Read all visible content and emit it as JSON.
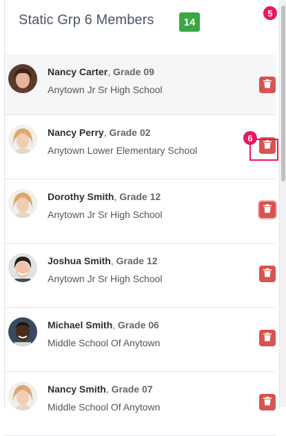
{
  "header": {
    "title": "Static Grp 6 Members",
    "member_count": "14"
  },
  "markers": {
    "m5": "5",
    "m6": "6"
  },
  "members": [
    {
      "name": "Nancy Carter",
      "sep": ", ",
      "grade": "Grade 09",
      "school": "Anytown Jr Sr High School"
    },
    {
      "name": "Nancy Perry",
      "sep": ", ",
      "grade": "Grade 02",
      "school": "Anytown Lower Elementary School"
    },
    {
      "name": "Dorothy Smith",
      "sep": ", ",
      "grade": "Grade 12",
      "school": "Anytown Jr Sr High School"
    },
    {
      "name": "Joshua Smith",
      "sep": ", ",
      "grade": "Grade 12",
      "school": "Anytown Jr Sr High School"
    },
    {
      "name": "Michael Smith",
      "sep": ", ",
      "grade": "Grade 06",
      "school": "Middle School Of Anytown"
    },
    {
      "name": "Nancy Smith",
      "sep": ", ",
      "grade": "Grade 07",
      "school": "Middle School Of Anytown"
    }
  ],
  "colors": {
    "badge": "#3aa745",
    "delete": "#d9534f",
    "marker": "#e8185a"
  }
}
